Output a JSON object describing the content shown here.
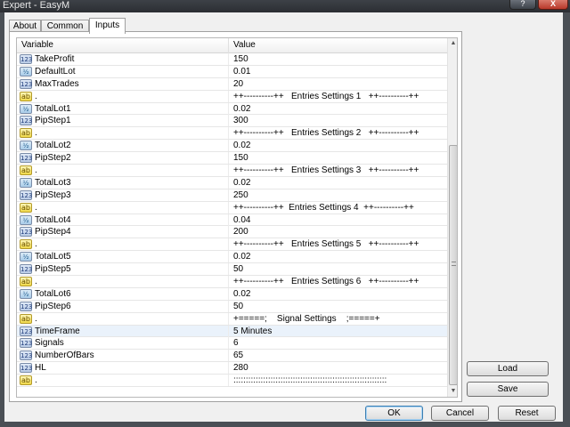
{
  "window": {
    "title": "Expert - EasyM",
    "help_label": "?",
    "close_label": "X"
  },
  "tabs": [
    {
      "label": "About"
    },
    {
      "label": "Common"
    },
    {
      "label": "Inputs"
    }
  ],
  "grid": {
    "col_variable": "Variable",
    "col_value": "Value",
    "rows": [
      {
        "type": "int",
        "icon_label": "123",
        "name": "TakeProfit",
        "value": "150"
      },
      {
        "type": "dbl",
        "icon_label": "½",
        "name": "DefaultLot",
        "value": "0.01"
      },
      {
        "type": "int",
        "icon_label": "123",
        "name": "MaxTrades",
        "value": "20"
      },
      {
        "type": "str",
        "icon_label": "ab",
        "name": ".",
        "value": "++----------++   Entries Settings 1   ++----------++"
      },
      {
        "type": "dbl",
        "icon_label": "½",
        "name": "TotalLot1",
        "value": "0.02"
      },
      {
        "type": "int",
        "icon_label": "123",
        "name": "PipStep1",
        "value": "300"
      },
      {
        "type": "str",
        "icon_label": "ab",
        "name": ".",
        "value": "++----------++   Entries Settings 2   ++----------++"
      },
      {
        "type": "dbl",
        "icon_label": "½",
        "name": "TotalLot2",
        "value": "0.02"
      },
      {
        "type": "int",
        "icon_label": "123",
        "name": "PipStep2",
        "value": "150"
      },
      {
        "type": "str",
        "icon_label": "ab",
        "name": ".",
        "value": "++----------++   Entries Settings 3   ++----------++"
      },
      {
        "type": "dbl",
        "icon_label": "½",
        "name": "TotalLot3",
        "value": "0.02"
      },
      {
        "type": "int",
        "icon_label": "123",
        "name": "PipStep3",
        "value": "250"
      },
      {
        "type": "str",
        "icon_label": "ab",
        "name": ".",
        "value": "++----------++  Entries Settings 4  ++----------++"
      },
      {
        "type": "dbl",
        "icon_label": "½",
        "name": "TotalLot4",
        "value": "0.04"
      },
      {
        "type": "int",
        "icon_label": "123",
        "name": "PipStep4",
        "value": "200"
      },
      {
        "type": "str",
        "icon_label": "ab",
        "name": ".",
        "value": "++----------++   Entries Settings 5   ++----------++"
      },
      {
        "type": "dbl",
        "icon_label": "½",
        "name": "TotalLot5",
        "value": "0.02"
      },
      {
        "type": "int",
        "icon_label": "123",
        "name": "PipStep5",
        "value": "50"
      },
      {
        "type": "str",
        "icon_label": "ab",
        "name": ".",
        "value": "++----------++   Entries Settings 6   ++----------++"
      },
      {
        "type": "dbl",
        "icon_label": "½",
        "name": "TotalLot6",
        "value": "0.02"
      },
      {
        "type": "int",
        "icon_label": "123",
        "name": "PipStep6",
        "value": "50"
      },
      {
        "type": "str",
        "icon_label": "ab",
        "name": ".",
        "value": "+=====;    Signal Settings    ;=====+"
      },
      {
        "type": "int",
        "icon_label": "123",
        "name": "TimeFrame",
        "value": "5 Minutes",
        "selected": true
      },
      {
        "type": "int",
        "icon_label": "123",
        "name": "Signals",
        "value": "6"
      },
      {
        "type": "int",
        "icon_label": "123",
        "name": "NumberOfBars",
        "value": "65"
      },
      {
        "type": "int",
        "icon_label": "123",
        "name": "HL",
        "value": "280"
      },
      {
        "type": "str",
        "icon_label": "ab",
        "name": ".",
        "value": "::::::::::::::::::::::::::::::::::::::::::::::::::::::::::::::"
      }
    ]
  },
  "side_buttons": {
    "load": "Load",
    "save": "Save"
  },
  "footer_buttons": {
    "ok": "OK",
    "cancel": "Cancel",
    "reset": "Reset"
  }
}
